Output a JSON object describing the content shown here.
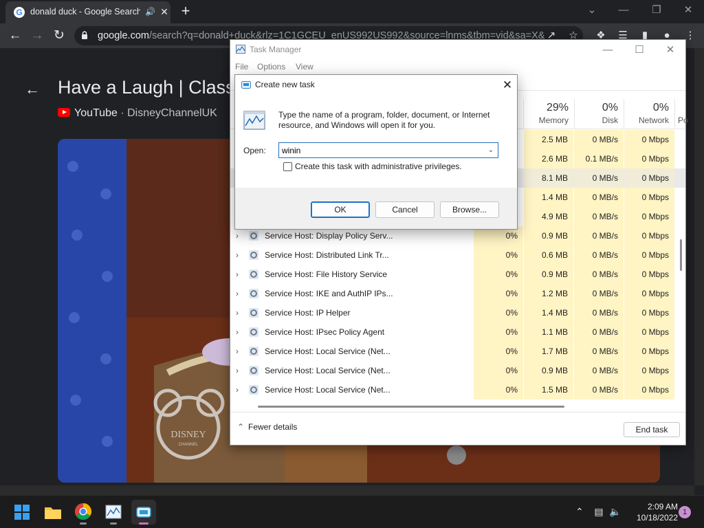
{
  "browser": {
    "tab_title": "donald duck - Google Search",
    "url_host": "google.com",
    "url_rest": "/search?q=donald+duck&rlz=1C1GCEU_enUS992US992&source=lnms&tbm=vid&sa=X&...",
    "video_title": "Have a Laugh | Classic Donald Duck",
    "source_site": "YouTube",
    "source_channel": "DisneyChannelUK",
    "source_sep": " · ",
    "video_watermark": "DISNEY CHANNEL"
  },
  "task_manager": {
    "title": "Task Manager",
    "menu": [
      "File",
      "Options",
      "View"
    ],
    "columns": [
      {
        "pct": "29%",
        "label": "Memory"
      },
      {
        "pct": "0%",
        "label": "Disk"
      },
      {
        "pct": "0%",
        "label": "Network"
      },
      {
        "pct": "",
        "label": "Po"
      }
    ],
    "hidden_rows": [
      {
        "memory": "2.5 MB",
        "disk": "0 MB/s",
        "network": "0 Mbps"
      },
      {
        "memory": "2.6 MB",
        "disk": "0.1 MB/s",
        "network": "0 Mbps"
      },
      {
        "memory": "8.1 MB",
        "disk": "0 MB/s",
        "network": "0 Mbps"
      },
      {
        "memory": "1.4 MB",
        "disk": "0 MB/s",
        "network": "0 Mbps"
      },
      {
        "memory": "4.9 MB",
        "disk": "0 MB/s",
        "network": "0 Mbps"
      }
    ],
    "rows": [
      {
        "name": "Service Host: Display Policy Serv...",
        "cpu": "0%",
        "memory": "0.9 MB",
        "disk": "0 MB/s",
        "network": "0 Mbps"
      },
      {
        "name": "Service Host: Distributed Link Tr...",
        "cpu": "0%",
        "memory": "0.6 MB",
        "disk": "0 MB/s",
        "network": "0 Mbps"
      },
      {
        "name": "Service Host: File History Service",
        "cpu": "0%",
        "memory": "0.9 MB",
        "disk": "0 MB/s",
        "network": "0 Mbps"
      },
      {
        "name": "Service Host: IKE and AuthIP IPs...",
        "cpu": "0%",
        "memory": "1.2 MB",
        "disk": "0 MB/s",
        "network": "0 Mbps"
      },
      {
        "name": "Service Host: IP Helper",
        "cpu": "0%",
        "memory": "1.4 MB",
        "disk": "0 MB/s",
        "network": "0 Mbps"
      },
      {
        "name": "Service Host: IPsec Policy Agent",
        "cpu": "0%",
        "memory": "1.1 MB",
        "disk": "0 MB/s",
        "network": "0 Mbps"
      },
      {
        "name": "Service Host: Local Service (Net...",
        "cpu": "0%",
        "memory": "1.7 MB",
        "disk": "0 MB/s",
        "network": "0 Mbps"
      },
      {
        "name": "Service Host: Local Service (Net...",
        "cpu": "0%",
        "memory": "0.9 MB",
        "disk": "0 MB/s",
        "network": "0 Mbps"
      },
      {
        "name": "Service Host: Local Service (Net...",
        "cpu": "0%",
        "memory": "1.5 MB",
        "disk": "0 MB/s",
        "network": "0 Mbps"
      }
    ],
    "fewer_details": "Fewer details",
    "end_task": "End task"
  },
  "dialog": {
    "title": "Create new task",
    "message": "Type the name of a program, folder, document, or Internet resource, and Windows will open it for you.",
    "open_label": "Open:",
    "open_value": "winin",
    "admin_label": "Create this task with administrative privileges.",
    "ok": "OK",
    "cancel": "Cancel",
    "browse": "Browse..."
  },
  "taskbar": {
    "time": "2:09 AM",
    "date": "10/18/2022",
    "notifications": "1"
  },
  "colors": {
    "chrome_bg": "#202124",
    "heat_cell": "#fff4c4",
    "accent": "#1a73c9"
  }
}
